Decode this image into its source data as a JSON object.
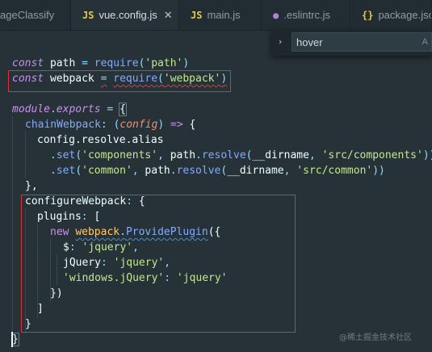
{
  "tabs": [
    {
      "label": "ageClassify",
      "icon": "",
      "active": false
    },
    {
      "label": "vue.config.js",
      "icon": "JS",
      "active": true,
      "close": "✕"
    },
    {
      "label": "main.js",
      "icon": "JS",
      "active": false
    },
    {
      "label": ".eslintrc.js",
      "icon": "●",
      "active": false
    },
    {
      "label": "package.json",
      "icon": "{}",
      "active": false
    }
  ],
  "find": {
    "chevron": "›",
    "value": "hover",
    "option": "A"
  },
  "code": {
    "l1": {
      "kw": "const",
      "name": " path ",
      "eq": "=",
      "fn": "require",
      "o": "(",
      "s": "'path'",
      "c": ")"
    },
    "l2": {
      "kw": "const",
      "name": " webpack ",
      "eq": "=",
      "fn": "require",
      "o": "(",
      "s": "'webpack'",
      "c": ")"
    },
    "l4": {
      "kw": "module",
      "dot": ".",
      "kw2": "exports",
      "eq": " = ",
      "b": "{"
    },
    "l5": {
      "name": "chainWebpack",
      "colon": ": ",
      "o": "(",
      "prm": "config",
      "c": ")",
      "arrow": " => ",
      "b": "{"
    },
    "l6": {
      "text": "config.resolve.alias"
    },
    "l7": {
      "dot": ".",
      "fn": "set",
      "o": "(",
      "s1": "'components'",
      "comma": ", ",
      "obj": "path",
      "dot2": ".",
      "fn2": "resolve",
      "o2": "(",
      "dn": "__dirname",
      "comma2": ", ",
      "s2": "'src/components'",
      "c": "))"
    },
    "l8": {
      "dot": ".",
      "fn": "set",
      "o": "(",
      "s1": "'common'",
      "comma": ", ",
      "obj": "path",
      "dot2": ".",
      "fn2": "resolve",
      "o2": "(",
      "dn": "__dirname",
      "comma2": ", ",
      "s2": "'src/common'",
      "c": "))"
    },
    "l9": {
      "text": "},"
    },
    "l10": {
      "name": "configureWebpack",
      "colon": ": ",
      "b": "{"
    },
    "l11": {
      "name": "plugins",
      "colon": ": ",
      "b": "["
    },
    "l12": {
      "kw": "new",
      "sp": " ",
      "cls": "webpack",
      "dot": ".",
      "fn": "ProvidePlugin",
      "o": "({"
    },
    "l13": {
      "key": "$",
      "colon": ": ",
      "s": "'jquery'",
      "comma": ","
    },
    "l14": {
      "key": "jQuery",
      "colon": ": ",
      "s": "'jquery'",
      "comma": ","
    },
    "l15": {
      "s1": "'windows.jQuery'",
      "colon": ": ",
      "s2": "'jquery'"
    },
    "l16": {
      "text": "})"
    },
    "l17": {
      "text": "]"
    },
    "l18": {
      "text": "}"
    },
    "l19": {
      "text": "}"
    }
  },
  "watermark": "@稀土掘金技术社区",
  "colors": {
    "background": "#263238",
    "keyword": "#c792ea",
    "function": "#82aaff",
    "string": "#c3e88d",
    "punctuation": "#89ddff",
    "highlight_box": "#e0303a"
  }
}
